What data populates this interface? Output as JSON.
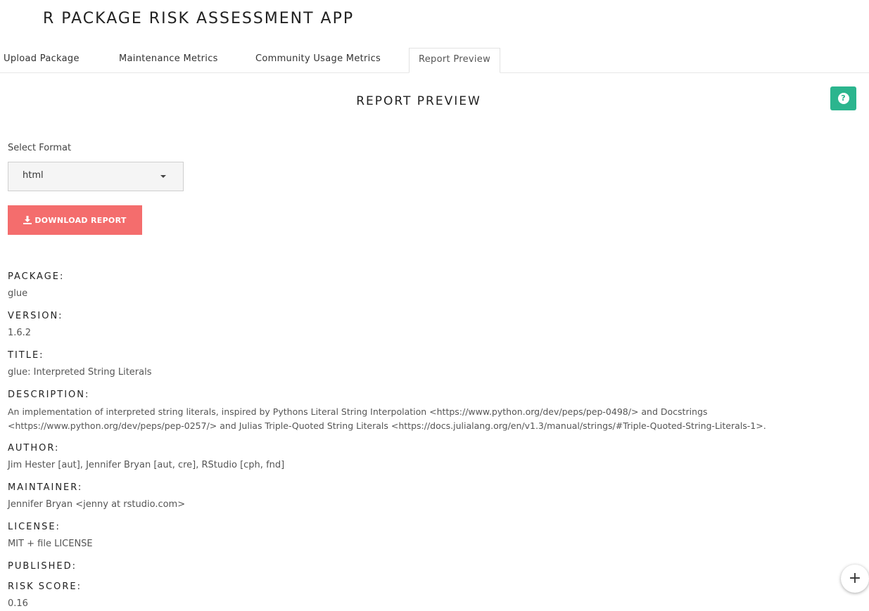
{
  "app": {
    "title": "R PACKAGE RISK ASSESSMENT APP"
  },
  "tabs": [
    {
      "label": "Upload Package"
    },
    {
      "label": "Maintenance Metrics"
    },
    {
      "label": "Community Usage Metrics"
    },
    {
      "label": "Report Preview",
      "active": true
    }
  ],
  "page": {
    "title": "REPORT PREVIEW",
    "help_icon": "question-circle-icon",
    "help_symbol": "?"
  },
  "format": {
    "label": "Select Format",
    "selected": "html",
    "icon": "caret-down-icon"
  },
  "download": {
    "label": "DOWNLOAD REPORT",
    "icon": "download-icon",
    "color": "#f46d6d"
  },
  "report": {
    "package_label": "PACKAGE:",
    "package_value": "glue",
    "version_label": "VERSION:",
    "version_value": "1.6.2",
    "title_label": "TITLE:",
    "title_value": "glue: Interpreted String Literals",
    "description_label": "DESCRIPTION:",
    "description_line1": "An implementation of interpreted string literals, inspired by Pythons Literal String Interpolation <https://www.python.org/dev/peps/pep-0498/> and Docstrings",
    "description_line2": "<https://www.python.org/dev/peps/pep-0257/> and Julias Triple-Quoted String Literals <https://docs.julialang.org/en/v1.3/manual/strings/#Triple-Quoted-String-Literals-1>.",
    "author_label": "AUTHOR:",
    "author_value": "Jim Hester [aut], Jennifer Bryan [aut, cre], RStudio [cph, fnd]",
    "maintainer_label": "MAINTAINER:",
    "maintainer_value": "Jennifer Bryan <jenny at rstudio.com>",
    "license_label": "LICENSE:",
    "license_value": "MIT + file LICENSE",
    "published_label": "PUBLISHED:",
    "risk_label": "RISK SCORE:",
    "risk_value": "0.16"
  },
  "fab": {
    "icon": "plus-icon",
    "symbol": "+"
  },
  "colors": {
    "accent_green": "#2bb58e",
    "download_red": "#f46d6d"
  }
}
